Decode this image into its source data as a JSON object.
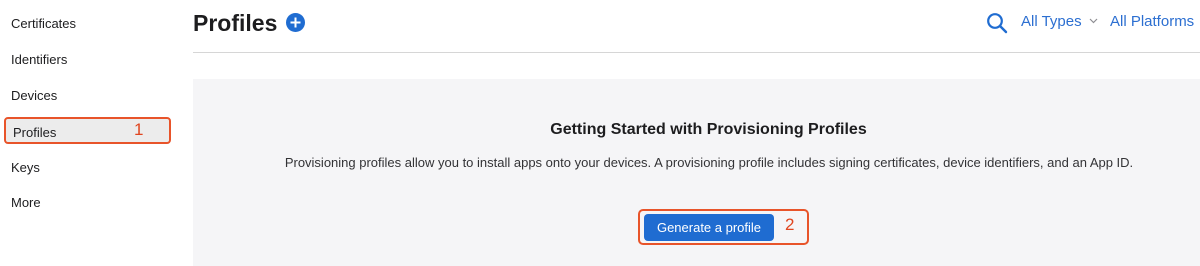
{
  "sidebar": {
    "items": [
      {
        "label": "Certificates"
      },
      {
        "label": "Identifiers"
      },
      {
        "label": "Devices"
      },
      {
        "label": "Profiles",
        "active": true
      },
      {
        "label": "Keys"
      },
      {
        "label": "More"
      }
    ]
  },
  "annotations": {
    "step1": "1",
    "step2": "2"
  },
  "header": {
    "title": "Profiles",
    "add_icon": "plus-circle-icon",
    "search_icon": "magnifier-icon",
    "filter_types": "All Types",
    "filter_platforms": "All Platforms"
  },
  "panel": {
    "heading": "Getting Started with Provisioning Profiles",
    "description": "Provisioning profiles allow you to install apps onto your devices. A provisioning profile includes signing certificates, device identifiers, and an App ID.",
    "button_label": "Generate a profile"
  },
  "colors": {
    "accent": "#1f6cd1",
    "link": "#2c6fd1",
    "annotation": "#e8542a",
    "panel_bg": "#f5f5f7"
  }
}
